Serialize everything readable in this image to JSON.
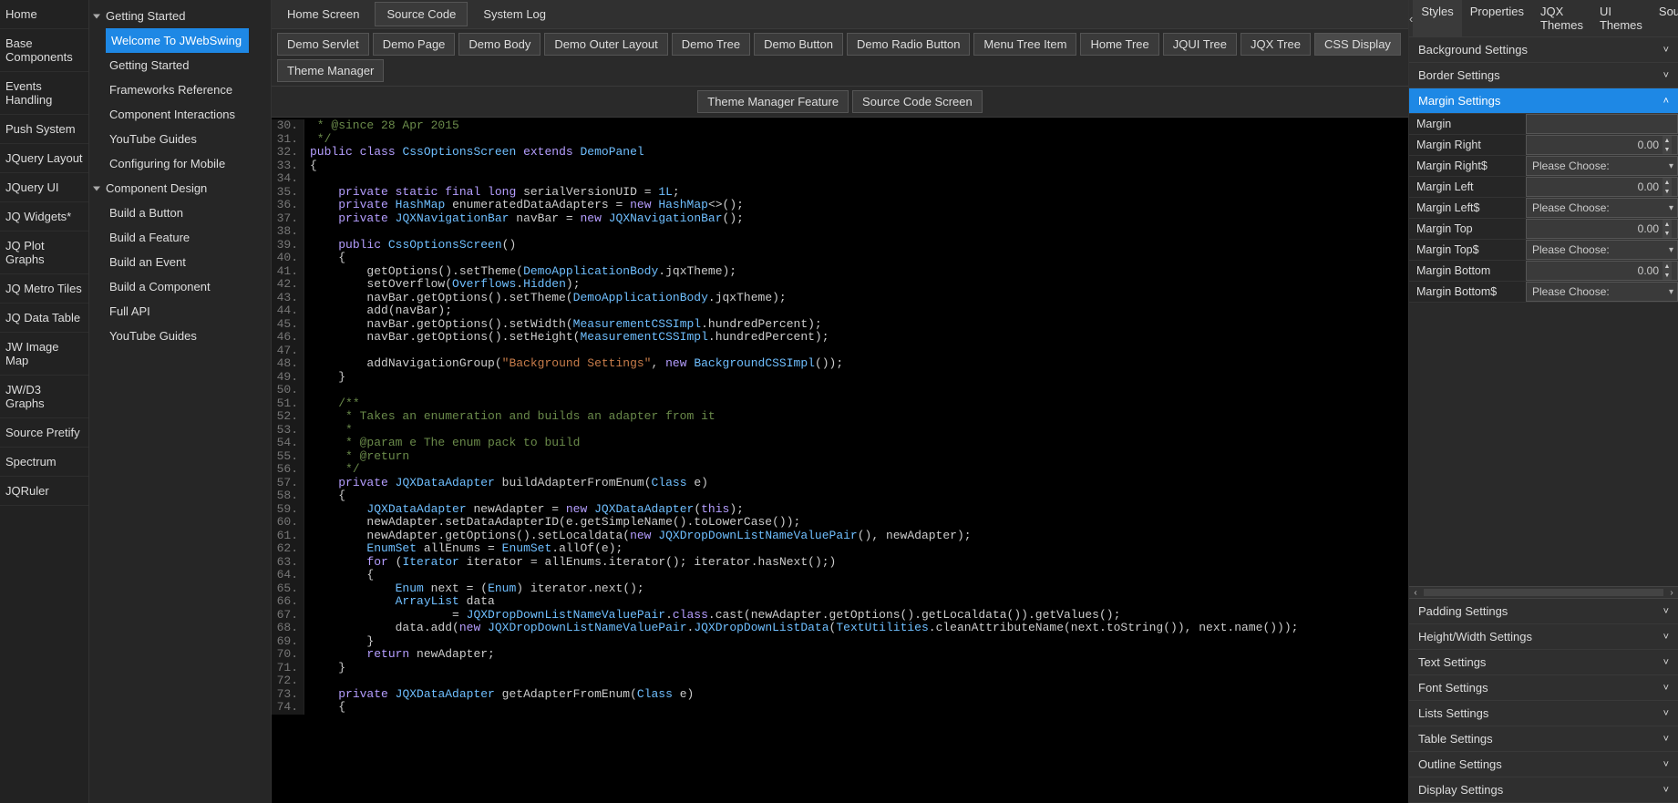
{
  "left_sidebar": [
    "Home",
    "Base Components",
    "Events Handling",
    "Push System",
    "JQuery Layout",
    "JQuery UI",
    "JQ Widgets*",
    "JQ Plot Graphs",
    "JQ Metro Tiles",
    "JQ Data Table",
    "JW Image Map",
    "JW/D3 Graphs",
    "Source Pretify",
    "Spectrum",
    "JQRuler"
  ],
  "tree": {
    "group1": {
      "label": "Getting Started",
      "items": [
        {
          "label": "Welcome To JWebSwing",
          "selected": true
        },
        {
          "label": "Getting Started"
        },
        {
          "label": "Frameworks Reference"
        },
        {
          "label": "Component Interactions"
        },
        {
          "label": "YouTube Guides"
        },
        {
          "label": "Configuring for Mobile"
        }
      ]
    },
    "group2": {
      "label": "Component Design",
      "items": [
        {
          "label": "Build a Button"
        },
        {
          "label": "Build a Feature"
        },
        {
          "label": "Build an Event"
        },
        {
          "label": "Build a Component"
        },
        {
          "label": "Full API"
        },
        {
          "label": "YouTube Guides"
        }
      ]
    }
  },
  "main_tabs": [
    {
      "label": "Home Screen",
      "active": false
    },
    {
      "label": "Source Code",
      "active": true
    },
    {
      "label": "System Log",
      "active": false
    }
  ],
  "demo_buttons_row1": [
    "Demo Servlet",
    "Demo Page",
    "Demo Body",
    "Demo Outer Layout",
    "Demo Tree",
    "Demo Button",
    "Demo Radio Button",
    "Menu Tree Item",
    "Home Tree",
    "JQUI Tree",
    "JQX Tree",
    "CSS Display",
    "Theme Manager"
  ],
  "demo_buttons_row1_active": "CSS Display",
  "demo_buttons_row2": [
    "Theme Manager Feature",
    "Source Code Screen"
  ],
  "right_tabs": {
    "items": [
      "Styles",
      "Properties",
      "JQX Themes",
      "UI Themes",
      "Source"
    ],
    "active": "Styles",
    "arrow_left": "‹",
    "arrow_right": "›"
  },
  "right_sections_top": [
    {
      "label": "Background Settings",
      "expanded": false
    },
    {
      "label": "Border Settings",
      "expanded": false
    },
    {
      "label": "Margin Settings",
      "expanded": true,
      "selected": true
    }
  ],
  "margin_props": [
    {
      "label": "Margin",
      "type": "blank"
    },
    {
      "label": "Margin Right",
      "type": "number",
      "value": "0.00"
    },
    {
      "label": "Margin Right$",
      "type": "dropdown",
      "value": "Please Choose:"
    },
    {
      "label": "Margin Left",
      "type": "number",
      "value": "0.00"
    },
    {
      "label": "Margin Left$",
      "type": "dropdown",
      "value": "Please Choose:"
    },
    {
      "label": "Margin Top",
      "type": "number",
      "value": "0.00"
    },
    {
      "label": "Margin Top$",
      "type": "dropdown",
      "value": "Please Choose:"
    },
    {
      "label": "Margin Bottom",
      "type": "number",
      "value": "0.00"
    },
    {
      "label": "Margin Bottom$",
      "type": "dropdown",
      "value": "Please Choose:"
    }
  ],
  "right_sections_bottom": [
    "Padding Settings",
    "Height/Width Settings",
    "Text Settings",
    "Font Settings",
    "Lists Settings",
    "Table Settings",
    "Outline Settings",
    "Display Settings"
  ],
  "code": [
    {
      "n": 30,
      "html": "<span class='c'> * @since 28 Apr 2015</span>"
    },
    {
      "n": 31,
      "html": "<span class='c'> */</span>"
    },
    {
      "n": 32,
      "html": "<span class='k'>public class</span> <span class='t'>CssOptionsScreen</span> <span class='k'>extends</span> <span class='t'>DemoPanel</span>"
    },
    {
      "n": 33,
      "html": "<span class='p'>{</span>"
    },
    {
      "n": 34,
      "html": ""
    },
    {
      "n": 35,
      "html": "    <span class='k'>private static final long</span> <span class='p'>serialVersionUID = </span><span class='t'>1L</span><span class='p'>;</span>"
    },
    {
      "n": 36,
      "html": "    <span class='k'>private</span> <span class='t'>HashMap</span> <span class='p'>enumeratedDataAdapters = </span><span class='k'>new</span> <span class='t'>HashMap</span><span class='p'>&lt;&gt;();</span>"
    },
    {
      "n": 37,
      "html": "    <span class='k'>private</span> <span class='t'>JQXNavigationBar</span> <span class='p'>navBar = </span><span class='k'>new</span> <span class='t'>JQXNavigationBar</span><span class='p'>();</span>"
    },
    {
      "n": 38,
      "html": ""
    },
    {
      "n": 39,
      "html": "    <span class='k'>public</span> <span class='t'>CssOptionsScreen</span><span class='p'>()</span>"
    },
    {
      "n": 40,
      "html": "    <span class='p'>{</span>"
    },
    {
      "n": 41,
      "html": "        <span class='p'>getOptions().setTheme(</span><span class='t'>DemoApplicationBody</span><span class='p'>.jqxTheme);</span>"
    },
    {
      "n": 42,
      "html": "        <span class='p'>setOverflow(</span><span class='t'>Overflows</span><span class='p'>.</span><span class='t'>Hidden</span><span class='p'>);</span>"
    },
    {
      "n": 43,
      "html": "        <span class='p'>navBar.getOptions().setTheme(</span><span class='t'>DemoApplicationBody</span><span class='p'>.jqxTheme);</span>"
    },
    {
      "n": 44,
      "html": "        <span class='p'>add(navBar);</span>"
    },
    {
      "n": 45,
      "html": "        <span class='p'>navBar.getOptions().setWidth(</span><span class='t'>MeasurementCSSImpl</span><span class='p'>.hundredPercent);</span>"
    },
    {
      "n": 46,
      "html": "        <span class='p'>navBar.getOptions().setHeight(</span><span class='t'>MeasurementCSSImpl</span><span class='p'>.hundredPercent);</span>"
    },
    {
      "n": 47,
      "html": ""
    },
    {
      "n": 48,
      "html": "        <span class='p'>addNavigationGroup(</span><span class='s'>\"Background Settings\"</span><span class='p'>, </span><span class='k'>new</span> <span class='t'>BackgroundCSSImpl</span><span class='p'>());</span>"
    },
    {
      "n": 49,
      "html": "    <span class='p'>}</span>"
    },
    {
      "n": 50,
      "html": ""
    },
    {
      "n": 51,
      "html": "    <span class='c'>/**</span>"
    },
    {
      "n": 52,
      "html": "    <span class='c'> * Takes an enumeration and builds an adapter from it</span>"
    },
    {
      "n": 53,
      "html": "    <span class='c'> *</span>"
    },
    {
      "n": 54,
      "html": "    <span class='c'> * @param e The enum pack to build</span>"
    },
    {
      "n": 55,
      "html": "    <span class='c'> * @return</span>"
    },
    {
      "n": 56,
      "html": "    <span class='c'> */</span>"
    },
    {
      "n": 57,
      "html": "    <span class='k'>private</span> <span class='t'>JQXDataAdapter</span> <span class='p'>buildAdapterFromEnum(</span><span class='t'>Class</span> <span class='p'>e)</span>"
    },
    {
      "n": 58,
      "html": "    <span class='p'>{</span>"
    },
    {
      "n": 59,
      "html": "        <span class='t'>JQXDataAdapter</span> <span class='p'>newAdapter = </span><span class='k'>new</span> <span class='t'>JQXDataAdapter</span><span class='p'>(</span><span class='k'>this</span><span class='p'>);</span>"
    },
    {
      "n": 60,
      "html": "        <span class='p'>newAdapter.setDataAdapterID(e.getSimpleName().toLowerCase());</span>"
    },
    {
      "n": 61,
      "html": "        <span class='p'>newAdapter.getOptions().setLocaldata(</span><span class='k'>new</span> <span class='t'>JQXDropDownListNameValuePair</span><span class='p'>(), newAdapter);</span>"
    },
    {
      "n": 62,
      "html": "        <span class='t'>EnumSet</span> <span class='p'>allEnums = </span><span class='t'>EnumSet</span><span class='p'>.allOf(e);</span>"
    },
    {
      "n": 63,
      "html": "        <span class='k'>for</span> <span class='p'>(</span><span class='t'>Iterator</span> <span class='p'>iterator = allEnums.iterator(); iterator.hasNext();)</span>"
    },
    {
      "n": 64,
      "html": "        <span class='p'>{</span>"
    },
    {
      "n": 65,
      "html": "            <span class='t'>Enum</span> <span class='p'>next = (</span><span class='t'>Enum</span><span class='p'>) iterator.next();</span>"
    },
    {
      "n": 66,
      "html": "            <span class='t'>ArrayList</span> <span class='p'>data</span>"
    },
    {
      "n": 67,
      "html": "                    <span class='p'>= </span><span class='t'>JQXDropDownListNameValuePair</span><span class='p'>.</span><span class='k'>class</span><span class='p'>.cast(newAdapter.getOptions().getLocaldata()).getValues();</span>"
    },
    {
      "n": 68,
      "html": "            <span class='p'>data.add(</span><span class='k'>new</span> <span class='t'>JQXDropDownListNameValuePair</span><span class='p'>.</span><span class='t'>JQXDropDownListData</span><span class='p'>(</span><span class='t'>TextUtilities</span><span class='p'>.cleanAttributeName(next.toString()), next.name()));</span>"
    },
    {
      "n": 69,
      "html": "        <span class='p'>}</span>"
    },
    {
      "n": 70,
      "html": "        <span class='k'>return</span> <span class='p'>newAdapter;</span>"
    },
    {
      "n": 71,
      "html": "    <span class='p'>}</span>"
    },
    {
      "n": 72,
      "html": ""
    },
    {
      "n": 73,
      "html": "    <span class='k'>private</span> <span class='t'>JQXDataAdapter</span> <span class='p'>getAdapterFromEnum(</span><span class='t'>Class</span> <span class='p'>e)</span>"
    },
    {
      "n": 74,
      "html": "    <span class='p'>{</span>"
    }
  ]
}
